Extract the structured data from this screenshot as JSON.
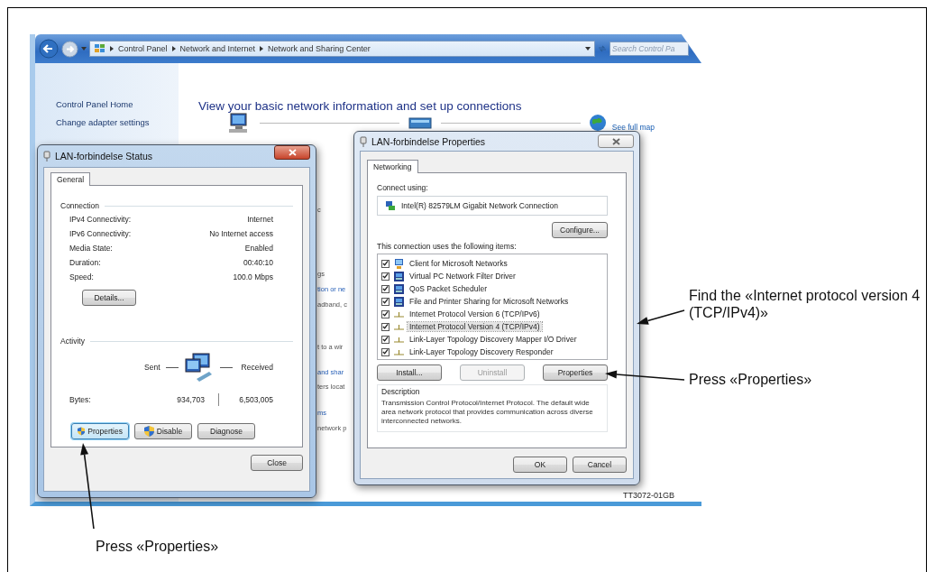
{
  "explorer": {
    "breadcrumb": [
      "Control Panel",
      "Network and Internet",
      "Network and Sharing Center"
    ],
    "search": {
      "placeholder": "Search Control Pa"
    },
    "sidebar": {
      "items": [
        "Control Panel Home",
        "Change adapter settings"
      ]
    },
    "heading": "View your basic network information and set up connections",
    "see_full_map": "See full map",
    "fragments": [
      {
        "text": "c",
        "kind": "text"
      },
      {
        "text": "gs",
        "kind": "text"
      },
      {
        "text": "tion or ne",
        "kind": "link"
      },
      {
        "text": "adband, c",
        "kind": "text"
      },
      {
        "text": "t to a wir",
        "kind": "text"
      },
      {
        "text": "and shar",
        "kind": "link"
      },
      {
        "text": "ters locat",
        "kind": "text"
      },
      {
        "text": "ms",
        "kind": "link"
      },
      {
        "text": "network p",
        "kind": "text"
      }
    ]
  },
  "status_dialog": {
    "title": "LAN-forbindelse Status",
    "tabs": [
      {
        "label": "General",
        "selected": true
      }
    ],
    "connection": {
      "label": "Connection",
      "rows": [
        {
          "label": "IPv4 Connectivity:",
          "value": "Internet"
        },
        {
          "label": "IPv6 Connectivity:",
          "value": "No Internet access"
        },
        {
          "label": "Media State:",
          "value": "Enabled"
        },
        {
          "label": "Duration:",
          "value": "00:40:10"
        },
        {
          "label": "Speed:",
          "value": "100.0 Mbps"
        }
      ]
    },
    "details_button": "Details...",
    "activity": {
      "label": "Activity",
      "sent_label": "Sent",
      "received_label": "Received",
      "bytes_label": "Bytes:",
      "bytes_sent": "934,703",
      "bytes_received": "6,503,005"
    },
    "buttons": [
      {
        "label": "Properties",
        "shield": true,
        "focused": true
      },
      {
        "label": "Disable",
        "shield": true,
        "focused": false
      },
      {
        "label": "Diagnose",
        "shield": false,
        "focused": false
      }
    ],
    "close_button": "Close"
  },
  "properties_dialog": {
    "title": "LAN-forbindelse Properties",
    "tabs": [
      {
        "label": "Networking",
        "selected": true
      }
    ],
    "connect_using_label": "Connect using:",
    "adapter": "Intel(R) 82579LM Gigabit Network Connection",
    "configure_button": "Configure...",
    "items_label": "This connection uses the following items:",
    "items": [
      {
        "label": "Client for Microsoft Networks",
        "kind": "client",
        "checked": true,
        "selected": false
      },
      {
        "label": "Virtual PC Network Filter Driver",
        "kind": "service",
        "checked": true,
        "selected": false
      },
      {
        "label": "QoS Packet Scheduler",
        "kind": "service",
        "checked": true,
        "selected": false
      },
      {
        "label": "File and Printer Sharing for Microsoft Networks",
        "kind": "service",
        "checked": true,
        "selected": false
      },
      {
        "label": "Internet Protocol Version 6 (TCP/IPv6)",
        "kind": "protocol",
        "checked": true,
        "selected": false
      },
      {
        "label": "Internet Protocol Version 4 (TCP/IPv4)",
        "kind": "protocol",
        "checked": true,
        "selected": true
      },
      {
        "label": "Link-Layer Topology Discovery Mapper I/O Driver",
        "kind": "protocol",
        "checked": true,
        "selected": false
      },
      {
        "label": "Link-Layer Topology Discovery Responder",
        "kind": "protocol",
        "checked": true,
        "selected": false
      }
    ],
    "buttons": [
      {
        "label": "Install...",
        "disabled": false
      },
      {
        "label": "Uninstall",
        "disabled": true
      },
      {
        "label": "Properties",
        "disabled": false
      }
    ],
    "description_label": "Description",
    "description": "Transmission Control Protocol/Internet Protocol. The default wide area network protocol that provides communication across diverse interconnected networks.",
    "ok_button": "OK",
    "cancel_button": "Cancel"
  },
  "figure_code": "TT3072-01GB",
  "callouts": [
    {
      "text": "Find the «Internet protocol version 4 (TCP/IPv4)»"
    },
    {
      "text": "Press «Properties»"
    },
    {
      "text": "Press «Properties»"
    }
  ]
}
